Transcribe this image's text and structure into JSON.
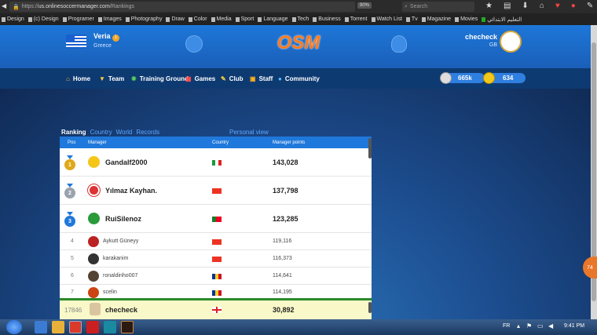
{
  "browser": {
    "url_prefix": "https://",
    "url_domain": "us.onlinesoccermanager.com",
    "url_path": "/Rankings",
    "zoom": "90%",
    "search_placeholder": "Search",
    "bookmarks": [
      "Design",
      "(c) Design",
      "Programer",
      "Images",
      "Photography",
      "Draw",
      "Color",
      "Media",
      "Sport",
      "Language",
      "Tech",
      "Business",
      "Torrent",
      "Watch List",
      "Tv",
      "Magazine",
      "Movies",
      "التعليم الابتدائي"
    ]
  },
  "header": {
    "team_name": "Veria",
    "team_country": "Greece",
    "logo": "OSM",
    "username": "checheck",
    "user_tag": "GB"
  },
  "nav": {
    "items": [
      "Home",
      "Team",
      "Training Ground",
      "Games",
      "Club",
      "Staff",
      "Community"
    ],
    "silver_coins": "665k",
    "gold_coins": "634"
  },
  "ranking": {
    "tabs": [
      "Ranking",
      "Country",
      "World",
      "Records"
    ],
    "personal_view": "Personal view",
    "columns": [
      "Pos",
      "Manager",
      "Country",
      "Manager points"
    ],
    "rows": [
      {
        "pos": "1",
        "name": "Gandalf2000",
        "points": "143,028"
      },
      {
        "pos": "2",
        "name": "Yılmaz Kayhan.",
        "points": "137,798"
      },
      {
        "pos": "3",
        "name": "RuiSilenoz",
        "points": "123,285"
      },
      {
        "pos": "4",
        "name": "Aykutt Güneyy",
        "points": "119,116"
      },
      {
        "pos": "5",
        "name": "karakanim",
        "points": "116,373"
      },
      {
        "pos": "6",
        "name": "ronaldinho007",
        "points": "114,641"
      },
      {
        "pos": "7",
        "name": "scelin",
        "points": "114,195"
      }
    ],
    "my_row": {
      "pos": "17846",
      "name": "checheck",
      "points": "30,892"
    }
  },
  "side_badge": "74",
  "taskbar": {
    "lang": "FR",
    "time": "9:41 PM"
  }
}
